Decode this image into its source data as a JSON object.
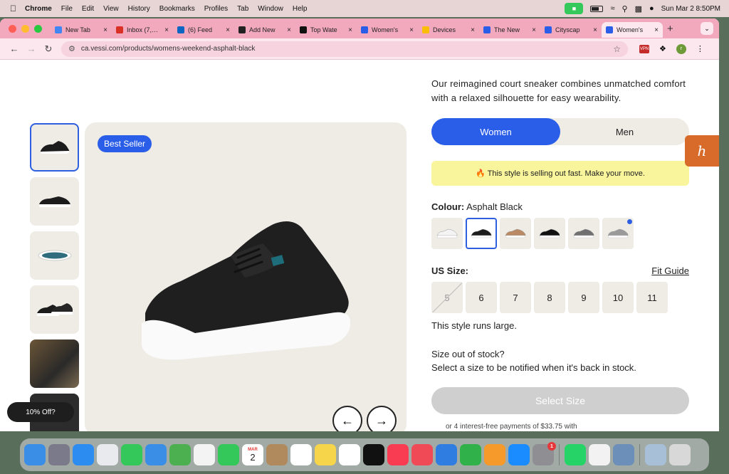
{
  "menubar": {
    "items": [
      "Chrome",
      "File",
      "Edit",
      "View",
      "History",
      "Bookmarks",
      "Profiles",
      "Tab",
      "Window",
      "Help"
    ],
    "datetime": "Sun Mar 2  8:50PM"
  },
  "tabs": [
    {
      "label": "New Tab",
      "color": "#4285f4"
    },
    {
      "label": "Inbox (7,…",
      "color": "#d93025"
    },
    {
      "label": "(6) Feed",
      "color": "#0a66c2"
    },
    {
      "label": "Add New",
      "color": "#222222"
    },
    {
      "label": "Top Wate",
      "color": "#111111"
    },
    {
      "label": "Women's",
      "color": "#2b5ee8"
    },
    {
      "label": "Devices",
      "color": "#fbbc04"
    },
    {
      "label": "The New",
      "color": "#2b5ee8"
    },
    {
      "label": "Cityscap",
      "color": "#2b5ee8"
    },
    {
      "label": "Women's",
      "color": "#2b5ee8"
    }
  ],
  "toolbar": {
    "url": "ca.vessi.com/products/womens-weekend-asphalt-black",
    "ext_label": "VPN",
    "avatar_initial": "r"
  },
  "product": {
    "description": "Our reimagined court sneaker combines unmatched comfort with a relaxed silhouette for easy wearability.",
    "badge": "Best Seller",
    "gender_options": [
      "Women",
      "Men"
    ],
    "selected_gender": "Women",
    "alert": "🔥 This style is selling out fast. Make your move.",
    "colour_label": "Colour:",
    "colour_value": "Asphalt Black",
    "swatches": [
      {
        "name": "white",
        "color": "#f4f4f4"
      },
      {
        "name": "asphalt-black",
        "color": "#1c1c1c"
      },
      {
        "name": "tan",
        "color": "#b98a65"
      },
      {
        "name": "all-black",
        "color": "#111111"
      },
      {
        "name": "grey",
        "color": "#707070"
      },
      {
        "name": "light-grey",
        "color": "#9a9a9a"
      }
    ],
    "size_label": "US Size:",
    "fit_guide": "Fit Guide",
    "sizes": [
      "5",
      "6",
      "7",
      "8",
      "9",
      "10",
      "11"
    ],
    "runs_note": "This style runs large.",
    "oos_line1": "Size out of stock?",
    "oos_line2": "Select a size to be notified when it's back in stock.",
    "select_button": "Select Size",
    "interest_text": "or 4 interest-free payments of $33.75 with"
  },
  "promo": "10% Off?",
  "honey_icon": "h",
  "dock": {
    "calendar_month": "MAR",
    "calendar_day": "2",
    "settings_badge": "1",
    "apps": [
      {
        "name": "finder",
        "color": "#3a8ee6"
      },
      {
        "name": "launchpad",
        "color": "#7a7a8a"
      },
      {
        "name": "safari",
        "color": "#2d8cf0"
      },
      {
        "name": "chrome",
        "color": "#e8eaed"
      },
      {
        "name": "messages",
        "color": "#34c759"
      },
      {
        "name": "mail",
        "color": "#3a8ee6"
      },
      {
        "name": "maps",
        "color": "#4caf50"
      },
      {
        "name": "photos",
        "color": "#f3f3f3"
      },
      {
        "name": "facetime",
        "color": "#34c759"
      },
      {
        "name": "calendar",
        "color": "#ffffff"
      },
      {
        "name": "contacts",
        "color": "#b08a5c"
      },
      {
        "name": "reminders",
        "color": "#ffffff"
      },
      {
        "name": "notes",
        "color": "#f7d54a"
      },
      {
        "name": "freeform",
        "color": "#ffffff"
      },
      {
        "name": "tv",
        "color": "#111111"
      },
      {
        "name": "music",
        "color": "#fa3c52"
      },
      {
        "name": "news",
        "color": "#f04a57"
      },
      {
        "name": "keynote",
        "color": "#2f7de1"
      },
      {
        "name": "numbers",
        "color": "#30b14a"
      },
      {
        "name": "pages",
        "color": "#f59a2b"
      },
      {
        "name": "app-store",
        "color": "#1a8cff"
      },
      {
        "name": "system-settings",
        "color": "#8e8e93"
      },
      {
        "name": "whatsapp",
        "color": "#25d366"
      },
      {
        "name": "textedit",
        "color": "#f2f2f2"
      },
      {
        "name": "preview",
        "color": "#6b8fb8"
      },
      {
        "name": "downloads",
        "color": "#a8bfd8"
      },
      {
        "name": "trash",
        "color": "#d8d8d8"
      }
    ]
  }
}
